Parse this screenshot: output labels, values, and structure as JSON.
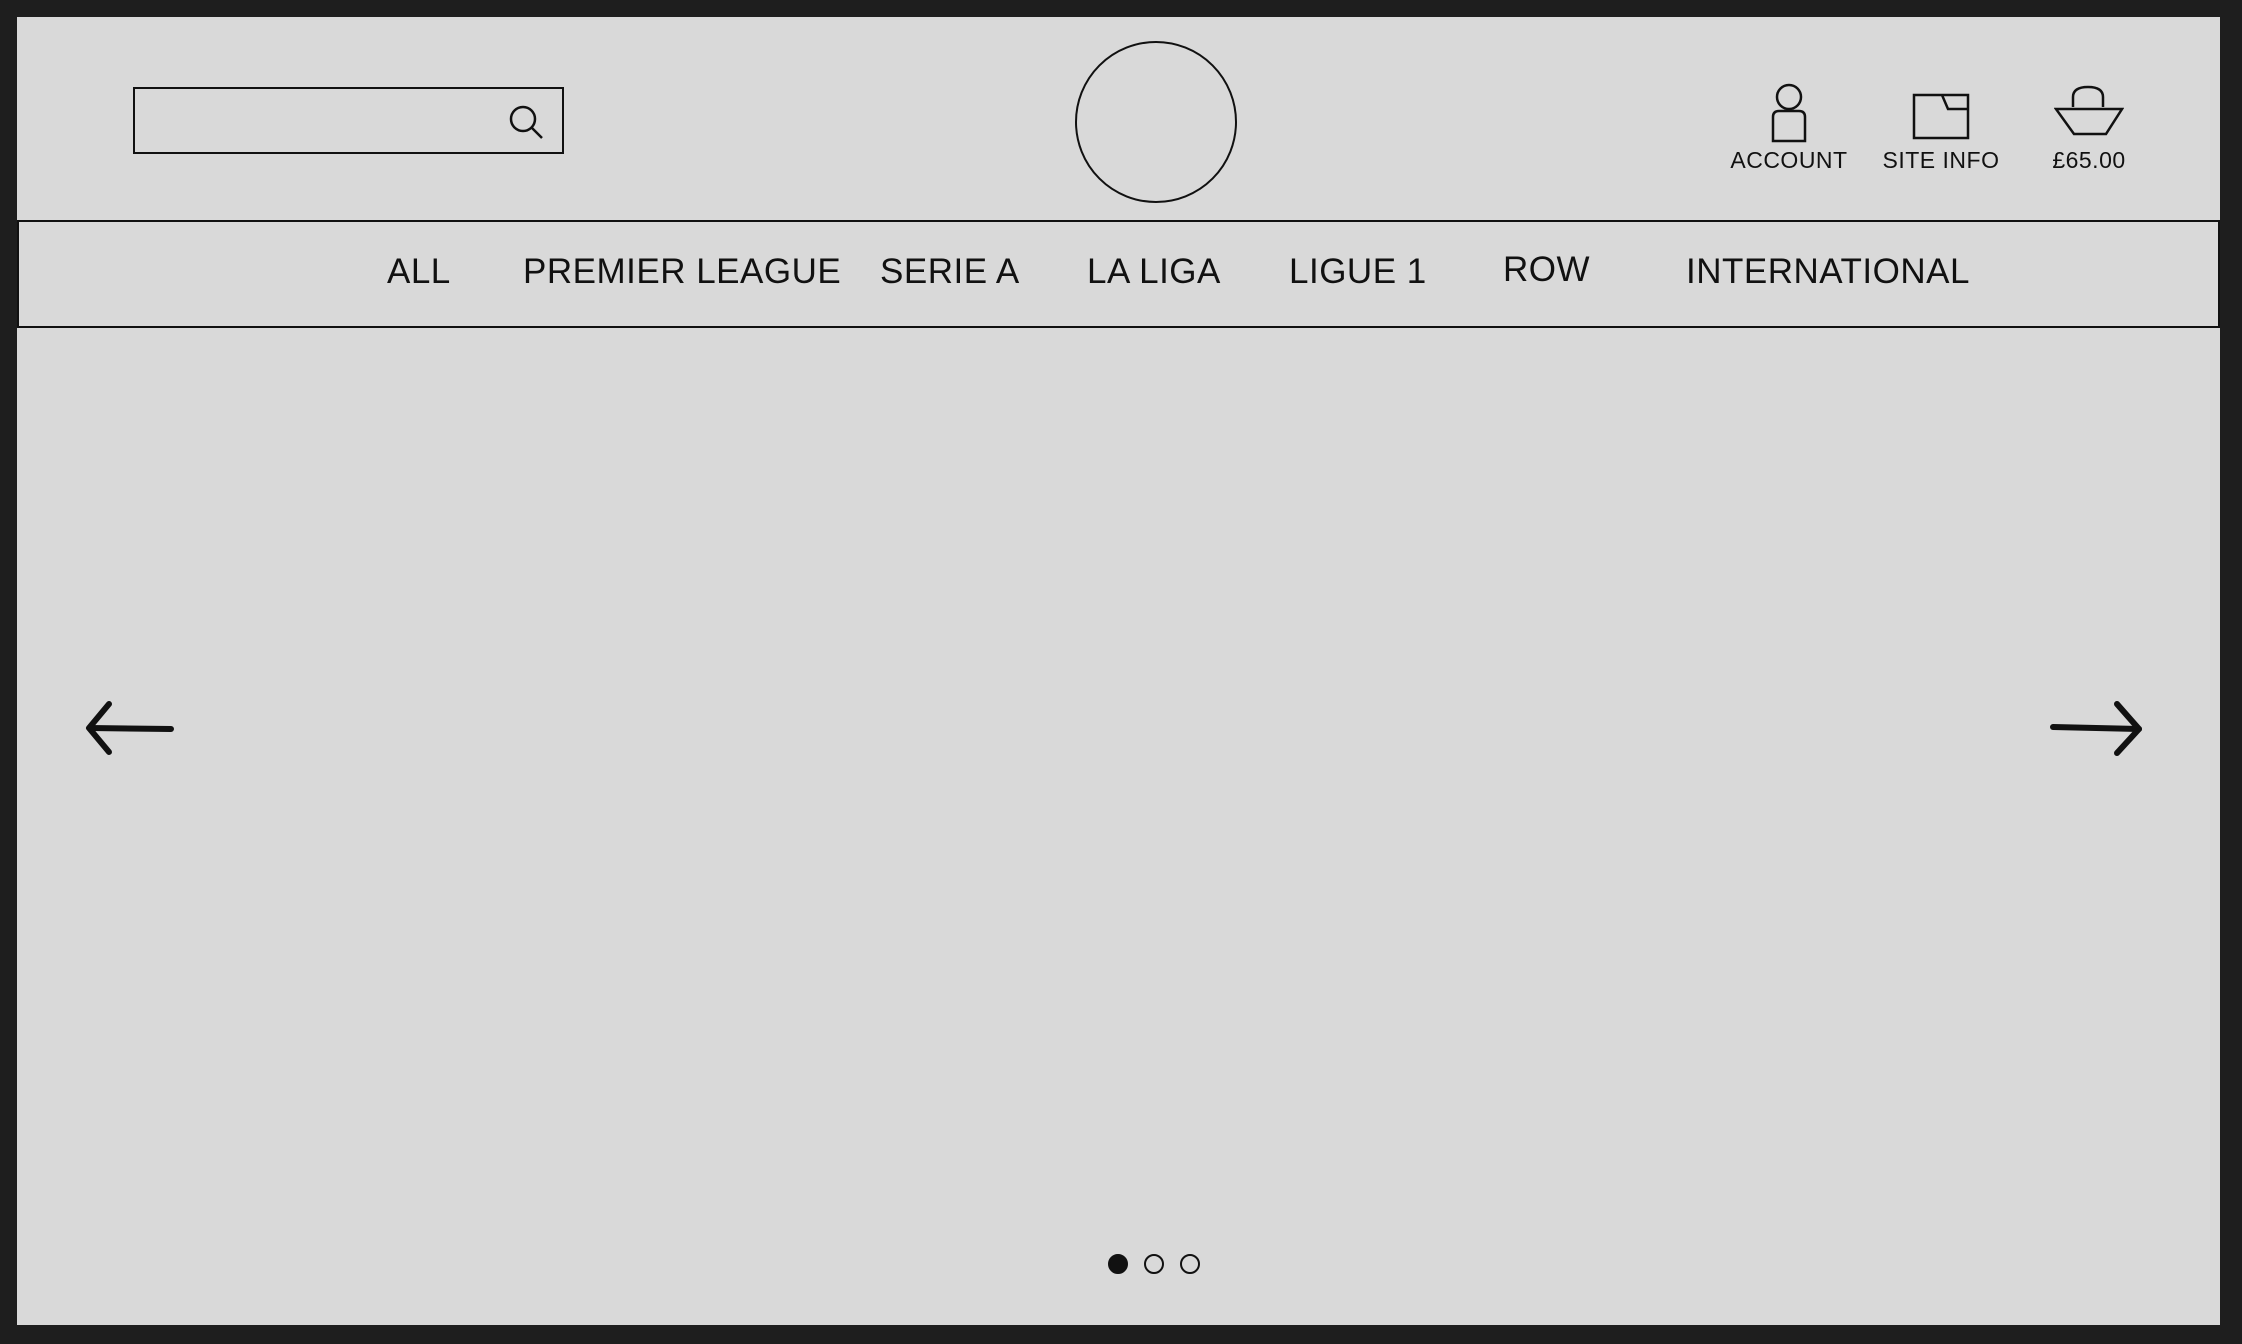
{
  "header": {
    "search": {
      "value": "",
      "placeholder": ""
    },
    "utilities": [
      {
        "label": "ACCOUNT",
        "icon": "account-icon"
      },
      {
        "label": "SITE INFO",
        "icon": "site-info-icon"
      },
      {
        "label": "£65.00",
        "icon": "basket-icon"
      }
    ]
  },
  "nav": {
    "items": [
      "ALL",
      "PREMIER LEAGUE",
      "SERIE A",
      "LA LIGA",
      "LIGUE 1",
      "ROW",
      "INTERNATIONAL"
    ]
  },
  "carousel": {
    "slide_count": 3,
    "active_slide": 1
  },
  "colors": {
    "background": "#d9d9d9",
    "frame": "#1e1e1e",
    "stroke": "#111111"
  }
}
